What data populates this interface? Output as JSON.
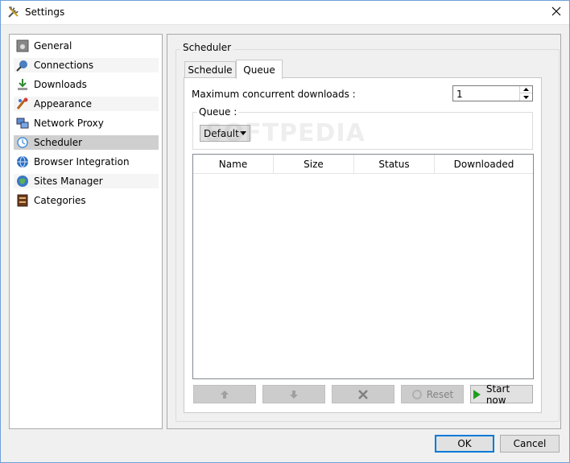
{
  "window": {
    "title": "Settings"
  },
  "sidebar": {
    "items": [
      {
        "label": "General",
        "icon": "general-icon"
      },
      {
        "label": "Connections",
        "icon": "connections-icon"
      },
      {
        "label": "Downloads",
        "icon": "downloads-icon"
      },
      {
        "label": "Appearance",
        "icon": "appearance-icon"
      },
      {
        "label": "Network Proxy",
        "icon": "network-proxy-icon"
      },
      {
        "label": "Scheduler",
        "icon": "scheduler-icon",
        "selected": true
      },
      {
        "label": "Browser Integration",
        "icon": "browser-integration-icon"
      },
      {
        "label": "Sites Manager",
        "icon": "sites-manager-icon"
      },
      {
        "label": "Categories",
        "icon": "categories-icon"
      }
    ]
  },
  "scheduler": {
    "group_title": "Scheduler",
    "tabs": [
      {
        "label": "Schedule",
        "active": false
      },
      {
        "label": "Queue",
        "active": true
      }
    ],
    "max_concurrent_label": "Maximum concurrent downloads :",
    "max_concurrent_value": "1",
    "queue_group_title": "Queue :",
    "queue_selected": "Default",
    "table_columns": [
      "Name",
      "Size",
      "Status",
      "Downloaded"
    ],
    "buttons": {
      "reset": "Reset",
      "start_now": "Start now"
    }
  },
  "dialog_buttons": {
    "ok": "OK",
    "cancel": "Cancel"
  },
  "watermark": "SOFTPEDIA",
  "colors": {
    "accent": "#0078d7",
    "selected_item": "#cfcfcf",
    "start_green": "#1e9e1e"
  }
}
